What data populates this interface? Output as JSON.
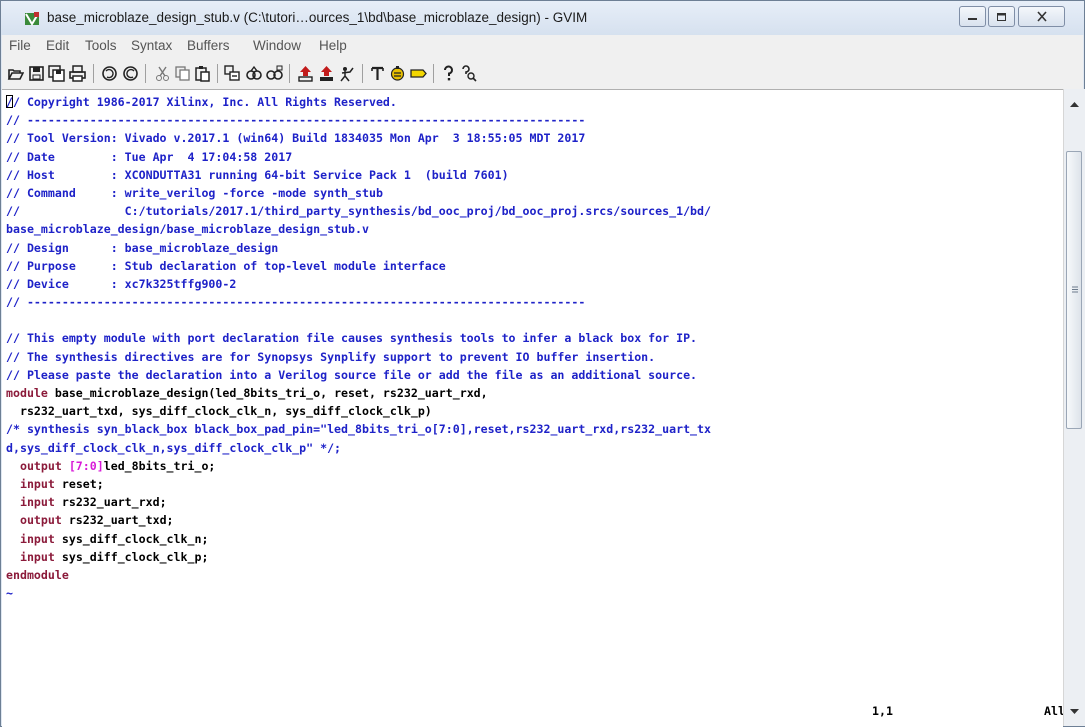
{
  "window": {
    "title": "base_microblaze_design_stub.v (C:\\tutori…ources_1\\bd\\base_microblaze_design) - GVIM"
  },
  "menu": {
    "items": [
      "File",
      "Edit",
      "Tools",
      "Syntax",
      "Buffers",
      "Window",
      "Help"
    ]
  },
  "toolbar": {
    "icons": [
      "open-icon",
      "save-icon",
      "save-all-icon",
      "print-icon",
      "undo-icon",
      "redo-icon",
      "cut-icon",
      "copy-icon",
      "paste-icon",
      "replace-icon",
      "find-next-icon",
      "find-prev-icon",
      "load-session-icon",
      "save-session-icon",
      "run-script-icon",
      "make-icon",
      "shell-icon",
      "ctags-icon",
      "help-icon",
      "find-help-icon"
    ]
  },
  "editor": {
    "lines": [
      {
        "type": "comment",
        "text": "// Copyright 1986-2017 Xilinx, Inc. All Rights Reserved."
      },
      {
        "type": "comment",
        "text": "// --------------------------------------------------------------------------------"
      },
      {
        "type": "comment",
        "text": "// Tool Version: Vivado v.2017.1 (win64) Build 1834035 Mon Apr  3 18:55:05 MDT 2017"
      },
      {
        "type": "comment",
        "text": "// Date        : Tue Apr  4 17:04:58 2017"
      },
      {
        "type": "comment",
        "text": "// Host        : XCONDUTTA31 running 64-bit Service Pack 1  (build 7601)"
      },
      {
        "type": "comment",
        "text": "// Command     : write_verilog -force -mode synth_stub"
      },
      {
        "type": "comment",
        "text": "//               C:/tutorials/2017.1/third_party_synthesis/bd_ooc_proj/bd_ooc_proj.srcs/sources_1/bd/"
      },
      {
        "type": "comment",
        "text": "base_microblaze_design/base_microblaze_design_stub.v"
      },
      {
        "type": "comment",
        "text": "// Design      : base_microblaze_design"
      },
      {
        "type": "comment",
        "text": "// Purpose     : Stub declaration of top-level module interface"
      },
      {
        "type": "comment",
        "text": "// Device      : xc7k325tffg900-2"
      },
      {
        "type": "comment",
        "text": "// --------------------------------------------------------------------------------"
      },
      {
        "type": "blank",
        "text": ""
      },
      {
        "type": "comment",
        "text": "// This empty module with port declaration file causes synthesis tools to infer a black box for IP."
      },
      {
        "type": "comment",
        "text": "// The synthesis directives are for Synopsys Synplify support to prevent IO buffer insertion."
      },
      {
        "type": "comment",
        "text": "// Please paste the declaration into a Verilog source file or add the file as an additional source."
      },
      {
        "type": "code",
        "kw": "module",
        "text": " base_microblaze_design(led_8bits_tri_o, reset, rs232_uart_rxd,"
      },
      {
        "type": "code",
        "kw": "",
        "text": "  rs232_uart_txd, sys_diff_clock_clk_n, sys_diff_clock_clk_p)"
      },
      {
        "type": "comment",
        "text": "/* synthesis syn_black_box black_box_pad_pin=\"led_8bits_tri_o[7:0],reset,rs232_uart_rxd,rs232_uart_tx"
      },
      {
        "type": "comment",
        "text": "d,sys_diff_clock_clk_n,sys_diff_clock_clk_p\" */;"
      },
      {
        "type": "port",
        "kw": "  output",
        "range": " [7:0]",
        "text": "led_8bits_tri_o;"
      },
      {
        "type": "port",
        "kw": "  input",
        "range": "",
        "text": " reset;"
      },
      {
        "type": "port",
        "kw": "  input",
        "range": "",
        "text": " rs232_uart_rxd;"
      },
      {
        "type": "port",
        "kw": "  output",
        "range": "",
        "text": " rs232_uart_txd;"
      },
      {
        "type": "port",
        "kw": "  input",
        "range": "",
        "text": " sys_diff_clock_clk_n;"
      },
      {
        "type": "port",
        "kw": "  input",
        "range": "",
        "text": " sys_diff_clock_clk_p;"
      },
      {
        "type": "code",
        "kw": "endmodule",
        "text": ""
      },
      {
        "type": "tilde",
        "text": "~"
      }
    ]
  },
  "status": {
    "position": "1,1",
    "scroll": "All"
  },
  "colors": {
    "comment": "#1e22c8",
    "keyword": "#8b1a3a",
    "number": "#d81bd8"
  }
}
